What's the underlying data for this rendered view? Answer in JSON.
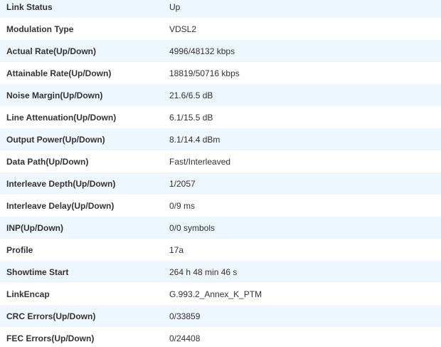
{
  "rows": [
    {
      "label": "Link Status",
      "value": "Up"
    },
    {
      "label": "Modulation Type",
      "value": "VDSL2"
    },
    {
      "label": "Actual Rate(Up/Down)",
      "value": "4996/48132 kbps"
    },
    {
      "label": "Attainable Rate(Up/Down)",
      "value": "18819/50716 kbps"
    },
    {
      "label": "Noise Margin(Up/Down)",
      "value": "21.6/6.5 dB"
    },
    {
      "label": "Line Attenuation(Up/Down)",
      "value": "6.1/15.5 dB"
    },
    {
      "label": "Output Power(Up/Down)",
      "value": "8.1/14.4 dBm"
    },
    {
      "label": "Data Path(Up/Down)",
      "value": "Fast/Interleaved"
    },
    {
      "label": "Interleave Depth(Up/Down)",
      "value": "1/2057"
    },
    {
      "label": "Interleave Delay(Up/Down)",
      "value": "0/9 ms"
    },
    {
      "label": "INP(Up/Down)",
      "value": "0/0 symbols"
    },
    {
      "label": "Profile",
      "value": "17a"
    },
    {
      "label": "Showtime Start",
      "value": "264 h 48 min 46 s"
    },
    {
      "label": "LinkEncap",
      "value": "G.993.2_Annex_K_PTM"
    },
    {
      "label": "CRC Errors(Up/Down)",
      "value": "0/33859"
    },
    {
      "label": "FEC Errors(Up/Down)",
      "value": "0/24408"
    }
  ]
}
